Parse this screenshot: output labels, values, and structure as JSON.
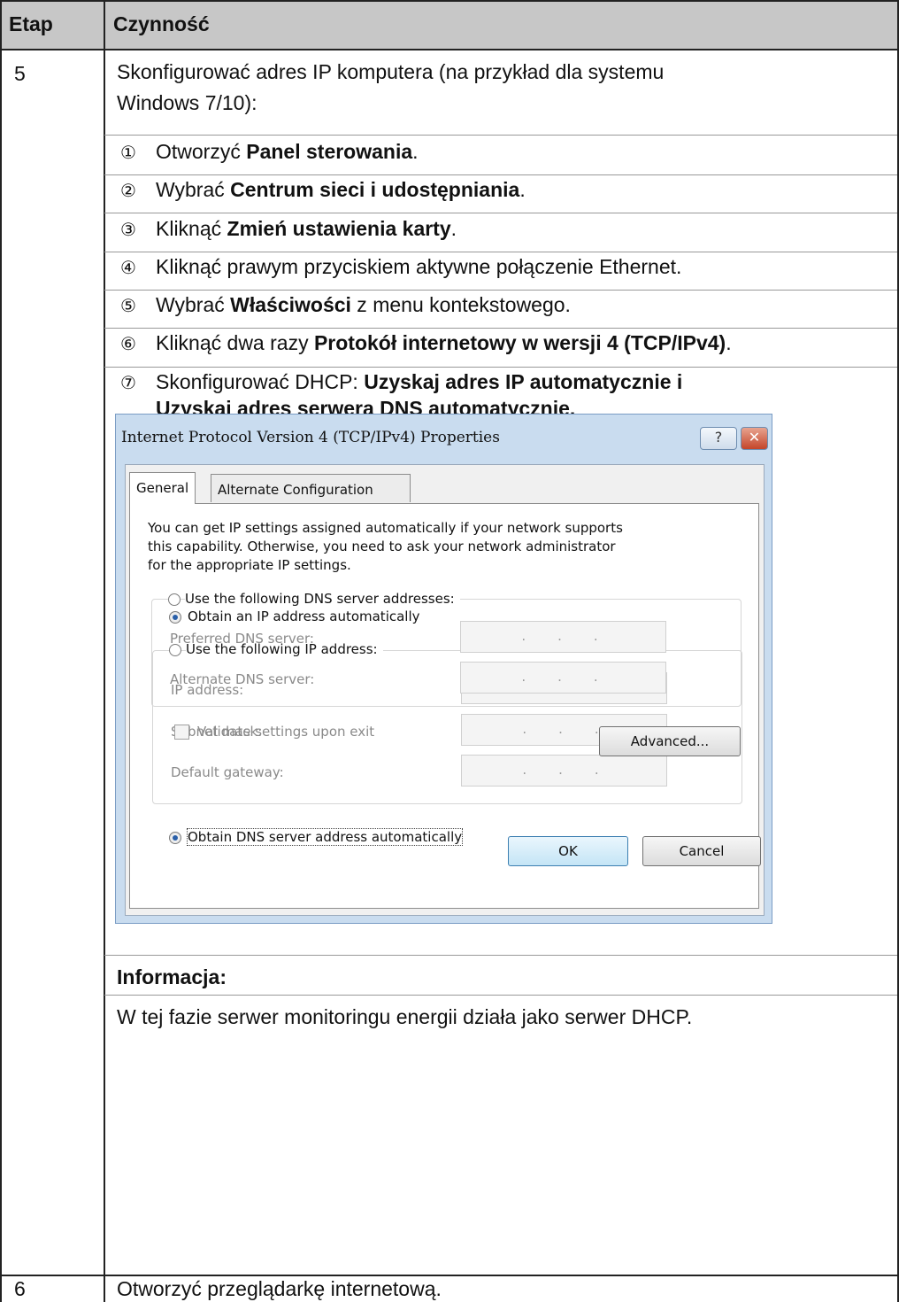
{
  "table": {
    "headers": [
      "Etap",
      "Czynność"
    ],
    "rows": [
      {
        "step": "5",
        "intro_line1": "Skonfigurować adres IP komputera (na przykład dla systemu",
        "intro_line2": "Windows 7/10):",
        "list": [
          {
            "num": "①",
            "pre": "Otworzyć ",
            "bold": "Panel sterowania",
            "post": "."
          },
          {
            "num": "②",
            "pre": "Wybrać ",
            "bold": "Centrum sieci i udostępniania",
            "post": "."
          },
          {
            "num": "③",
            "pre": "Kliknąć ",
            "bold": "Zmień ustawienia karty",
            "post": "."
          },
          {
            "num": "④",
            "pre": "Kliknąć prawym przyciskiem aktywne połączenie Ethernet.",
            "bold": "",
            "post": ""
          },
          {
            "num": "⑤",
            "pre": "Wybrać ",
            "bold": "Właściwości",
            "post": " z menu kontekstowego."
          },
          {
            "num": "⑥",
            "pre": "Kliknąć dwa razy ",
            "bold": "Protokół internetowy w wersji 4 (TCP/IPv4)",
            "post": "."
          },
          {
            "num": "⑦",
            "pre": "Skonfigurować DHCP: ",
            "bold": "Uzyskaj adres IP automatycznie i",
            "post": ""
          }
        ],
        "list7_line2": "Uzyskaj adres serwera DNS automatycznie.",
        "info_heading": "Informacja:",
        "info_text": "W tej fazie serwer monitoringu energii działa jako serwer DHCP."
      },
      {
        "step": "6",
        "text": "Otworzyć przeglądarkę internetową."
      }
    ]
  },
  "dialog": {
    "title": "Internet Protocol Version 4 (TCP/IPv4) Properties",
    "help_label": "?",
    "close_label": "✕",
    "tabs": [
      "General",
      "Alternate Configuration"
    ],
    "description": [
      "You can get IP settings assigned automatically if your network supports",
      "this capability. Otherwise, you need to ask your network administrator",
      "for the appropriate IP settings."
    ],
    "radio_obtain_ip": "Obtain an IP address automatically",
    "radio_use_ip": "Use the following IP address:",
    "ip_fields": [
      "IP address:",
      "Subnet mask:",
      "Default gateway:"
    ],
    "radio_obtain_dns": "Obtain DNS server address automatically",
    "radio_use_dns": "Use the following DNS server addresses:",
    "dns_fields": [
      "Preferred DNS server:",
      "Alternate DNS server:"
    ],
    "ip_placeholder": "...",
    "validate_label": "Validate settings upon exit",
    "advanced_label": "Advanced...",
    "ok_label": "OK",
    "cancel_label": "Cancel"
  }
}
